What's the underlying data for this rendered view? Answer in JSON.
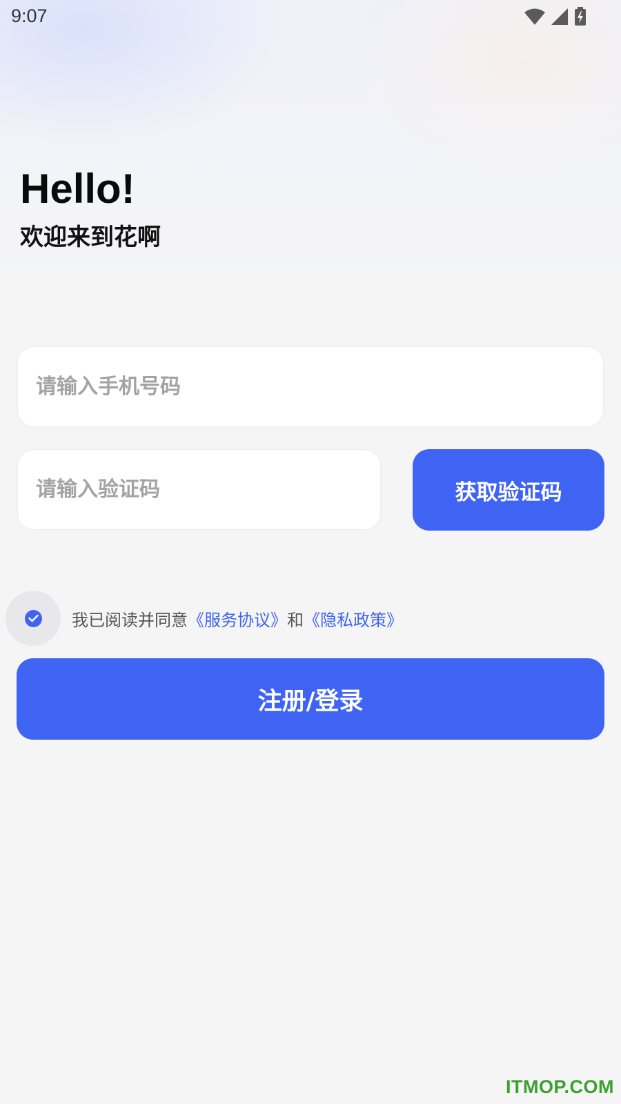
{
  "status_bar": {
    "time": "9:07",
    "icons": [
      "wifi-icon",
      "cell-signal-icon",
      "battery-charging-icon"
    ]
  },
  "greeting": {
    "title": "Hello!",
    "subtitle": "欢迎来到花啊"
  },
  "form": {
    "phone_placeholder": "请输入手机号码",
    "phone_value": "",
    "code_placeholder": "请输入验证码",
    "code_value": "",
    "get_code_label": "获取验证码"
  },
  "agreement": {
    "checked": true,
    "prefix": "我已阅读并同意",
    "service_link": "《服务协议》",
    "conjunction": "和",
    "privacy_link": "《隐私政策》"
  },
  "submit_label": "注册/登录",
  "watermark": "ITMOP.COM",
  "colors": {
    "primary": "#3f64f3",
    "background": "#f5f5f6",
    "watermark": "#3aa02e"
  }
}
